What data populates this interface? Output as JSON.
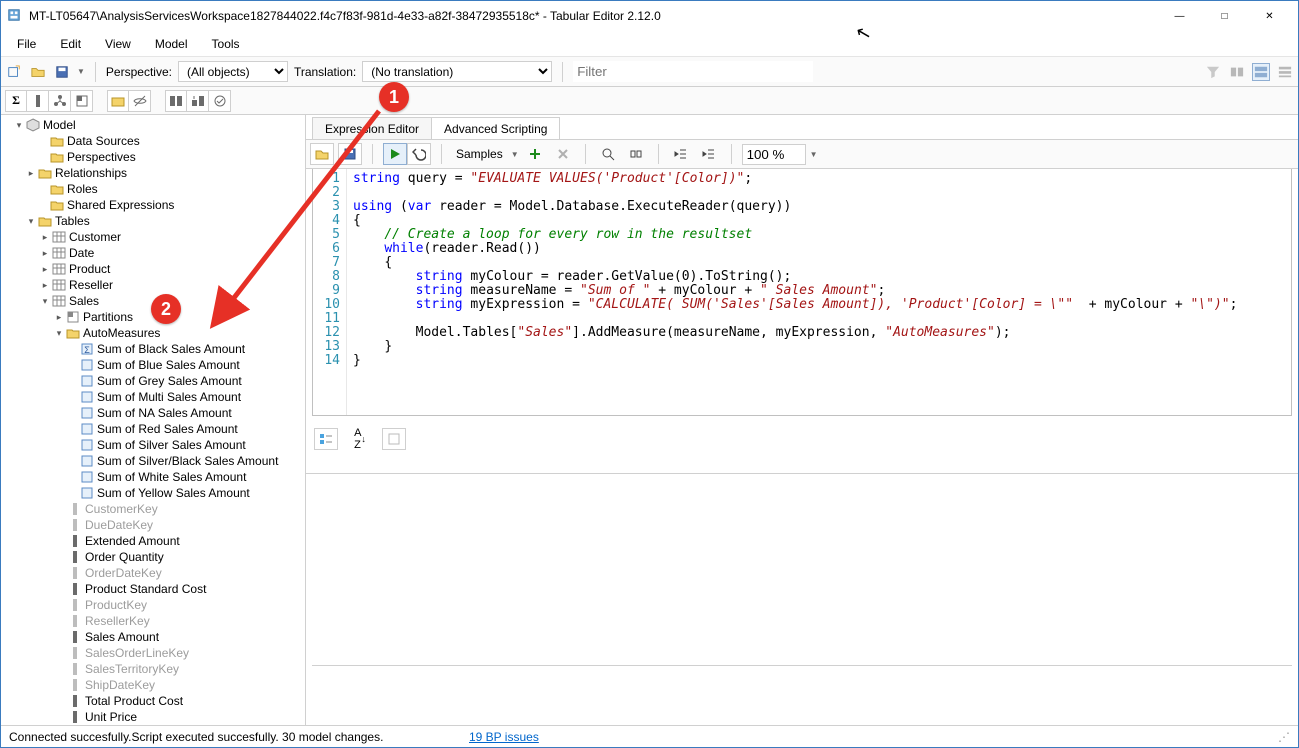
{
  "window": {
    "title": "MT-LT05647\\AnalysisServicesWorkspace1827844022.f4c7f83f-981d-4e33-a82f-38472935518c* - Tabular Editor 2.12.0"
  },
  "menubar": {
    "items": [
      "File",
      "Edit",
      "View",
      "Model",
      "Tools"
    ]
  },
  "toolbar": {
    "perspective_label": "Perspective:",
    "perspective_value": "(All objects)",
    "translation_label": "Translation:",
    "translation_value": "(No translation)",
    "filter_placeholder": "Filter"
  },
  "tree": {
    "model_label": "Model",
    "items": [
      {
        "label": "Data Sources",
        "type": "folder",
        "indent": 2
      },
      {
        "label": "Perspectives",
        "type": "folder",
        "indent": 2
      },
      {
        "label": "Relationships",
        "type": "node",
        "indent": 2,
        "twist": "collapsed"
      },
      {
        "label": "Roles",
        "type": "folder",
        "indent": 2
      },
      {
        "label": "Shared Expressions",
        "type": "folder",
        "indent": 2
      },
      {
        "label": "Tables",
        "type": "folder",
        "indent": 2,
        "twist": "expanded"
      }
    ],
    "tables": [
      "Customer",
      "Date",
      "Product",
      "Reseller",
      "Sales"
    ],
    "sales_children": [
      {
        "label": "Partitions",
        "type": "partitions",
        "twist": "collapsed"
      },
      {
        "label": "AutoMeasures",
        "type": "folder",
        "twist": "expanded"
      }
    ],
    "auto_measures": [
      "Sum of Black Sales Amount",
      "Sum of Blue Sales Amount",
      "Sum of Grey Sales Amount",
      "Sum of Multi Sales Amount",
      "Sum of NA Sales Amount",
      "Sum of Red Sales Amount",
      "Sum of Silver Sales Amount",
      "Sum of Silver/Black Sales Amount",
      "Sum of White Sales Amount",
      "Sum of Yellow Sales Amount"
    ],
    "columns": [
      {
        "label": "CustomerKey",
        "dim": true
      },
      {
        "label": "DueDateKey",
        "dim": true
      },
      {
        "label": "Extended Amount",
        "dim": false
      },
      {
        "label": "Order Quantity",
        "dim": false
      },
      {
        "label": "OrderDateKey",
        "dim": true
      },
      {
        "label": "Product Standard Cost",
        "dim": false
      },
      {
        "label": "ProductKey",
        "dim": true
      },
      {
        "label": "ResellerKey",
        "dim": true
      },
      {
        "label": "Sales Amount",
        "dim": false
      },
      {
        "label": "SalesOrderLineKey",
        "dim": true
      },
      {
        "label": "SalesTerritoryKey",
        "dim": true
      },
      {
        "label": "ShipDateKey",
        "dim": true
      },
      {
        "label": "Total Product Cost",
        "dim": false
      },
      {
        "label": "Unit Price",
        "dim": false
      }
    ]
  },
  "tabs": {
    "expression": "Expression Editor",
    "scripting": "Advanced Scripting"
  },
  "scriptToolbar": {
    "samples": "Samples",
    "zoom": "100 %"
  },
  "code": {
    "l1a": "string",
    "l1b": " query = ",
    "l1c": "\"EVALUATE VALUES('Product'[Color])\"",
    "l1d": ";",
    "l3a": "using",
    "l3b": " (",
    "l3c": "var",
    "l3d": " reader = Model.Database.ExecuteReader(query))",
    "l4": "{",
    "l5c": "// Create a loop for every row in the resultset",
    "l6a": "while",
    "l6b": "(reader.Read())",
    "l7": "{",
    "l8a": "string",
    "l8b": " myColour = reader.GetValue(",
    "l8n": "0",
    "l8c": ").ToString();",
    "l9a": "string",
    "l9b": " measureName = ",
    "l9s1": "\"Sum of \"",
    "l9c": " + myColour + ",
    "l9s2": "\" Sales Amount\"",
    "l9d": ";",
    "l10a": "string",
    "l10b": " myExpression = ",
    "l10s1": "\"CALCULATE( SUM('Sales'[Sales Amount]), 'Product'[Color] = \\\"\"",
    "l10c": "  + myColour + ",
    "l10s2": "\"\\\")\"",
    "l10d": ";",
    "l12a": "Model.Tables[",
    "l12s": "\"Sales\"",
    "l12b": "].AddMeasure(measureName, myExpression, ",
    "l12s2": "\"AutoMeasures\"",
    "l12c": ");",
    "l13": "}",
    "l14": "}"
  },
  "statusbar": {
    "left": "Connected succesfully.",
    "bp": "19 BP issues",
    "right": "Script executed succesfully. 30 model changes."
  },
  "callouts": {
    "one": "1",
    "two": "2"
  }
}
